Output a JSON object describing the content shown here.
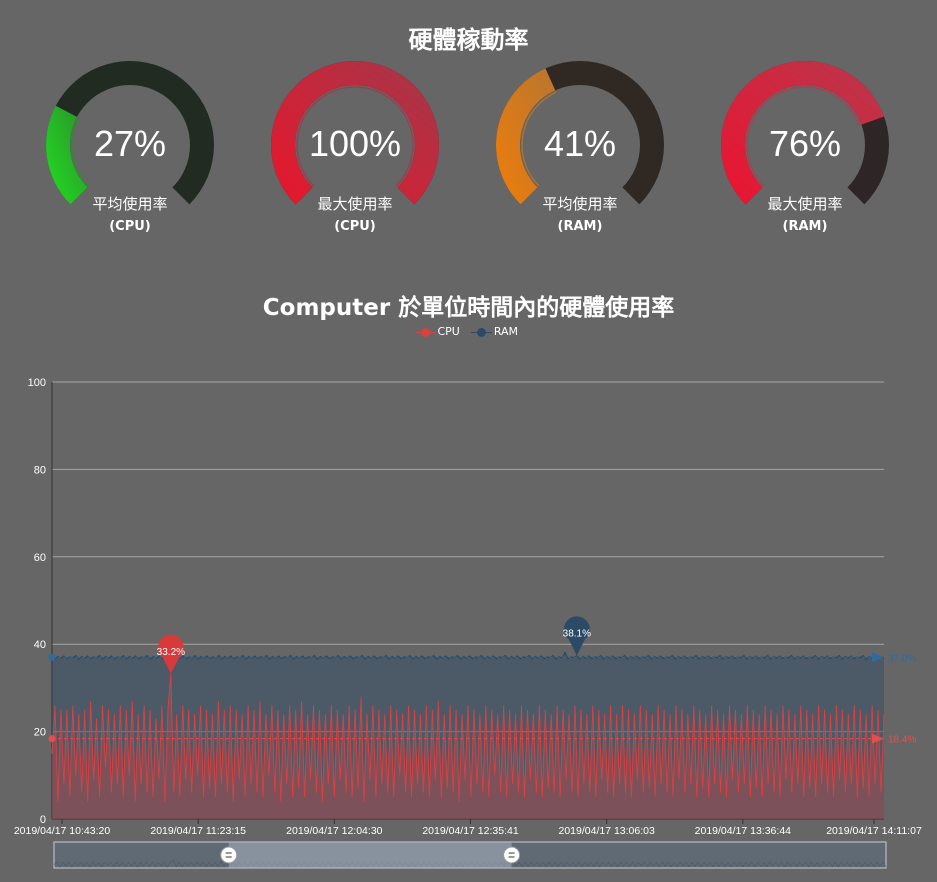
{
  "header": {
    "title": "硬體稼動率"
  },
  "gauges": [
    {
      "value_text": "27%",
      "value": 27,
      "label": "平均使用率",
      "sub": "(CPU)",
      "track_color": "#212b22",
      "fill_start": "#22e022",
      "fill_end": "#2b8e2b"
    },
    {
      "value_text": "100%",
      "value": 100,
      "label": "最大使用率",
      "sub": "(CPU)",
      "track_color": "#2a1d1d",
      "fill_start": "#e8162b",
      "fill_end": "#a3384a"
    },
    {
      "value_text": "41%",
      "value": 41,
      "label": "平均使用率",
      "sub": "(RAM)",
      "track_color": "#2f2823",
      "fill_start": "#ef7d0b",
      "fill_end": "#b8762f"
    },
    {
      "value_text": "76%",
      "value": 76,
      "label": "最大使用率",
      "sub": "(RAM)",
      "track_color": "#2e2527",
      "fill_start": "#ec1330",
      "fill_end": "#b8384c"
    }
  ],
  "chart_data": {
    "type": "area",
    "title": "Computer 於單位時間內的硬體使用率",
    "ylim": [
      0,
      100
    ],
    "y_ticks": [
      "0",
      "20",
      "40",
      "60",
      "80",
      "100"
    ],
    "x_ticks": [
      "2019/04/17 10:43:20",
      "2019/04/17 11:23:15",
      "2019/04/17 12:04:30",
      "2019/04/17 12:35:41",
      "2019/04/17 13:06:03",
      "2019/04/17 13:36:44",
      "2019/04/17 14:11:07"
    ],
    "grid": true,
    "legend_position": "top-center",
    "series": [
      {
        "name": "CPU",
        "color": "#d94141",
        "values": [
          15,
          26,
          4,
          25,
          8,
          25,
          5,
          26,
          10,
          24,
          6,
          25,
          4,
          27,
          9,
          23,
          5,
          26,
          12,
          25,
          6,
          24,
          8,
          26,
          5,
          25,
          10,
          27,
          4,
          24,
          8,
          26,
          6,
          25,
          5,
          23,
          9,
          26,
          4,
          25,
          33.2,
          6,
          24,
          5,
          26,
          9,
          25,
          6,
          24,
          10,
          26,
          5,
          25,
          7,
          24,
          5,
          27,
          8,
          25,
          6,
          26,
          4,
          25,
          9,
          24,
          5,
          26,
          8,
          25,
          6,
          27,
          5,
          24,
          10,
          26,
          6,
          25,
          4,
          24,
          8,
          26,
          5,
          25,
          7,
          27,
          5,
          24,
          9,
          26,
          6,
          25,
          4,
          24,
          8,
          26,
          5,
          25,
          9,
          24,
          6,
          26,
          5,
          25,
          7,
          28,
          4,
          24,
          9,
          26,
          5,
          25,
          8,
          24,
          6,
          26,
          5,
          25,
          10,
          24,
          6,
          26,
          5,
          25,
          8,
          24,
          6,
          26,
          5,
          25,
          9,
          27,
          5,
          24,
          7,
          26,
          6,
          25,
          4,
          24,
          9,
          26,
          5,
          25,
          8,
          24,
          6,
          26,
          5,
          25,
          10,
          24,
          6,
          26,
          5,
          25,
          8,
          24,
          6,
          26,
          5,
          25,
          9,
          24,
          6,
          26,
          5,
          25,
          7,
          24,
          6,
          26,
          5,
          25,
          9,
          24,
          6,
          26,
          5,
          25,
          8,
          24,
          6,
          26,
          5,
          25,
          9,
          24,
          6,
          26,
          5,
          24,
          8,
          26,
          6,
          25,
          5,
          24,
          9,
          26,
          6,
          25,
          7,
          24,
          5,
          26,
          8,
          25,
          6,
          24,
          5,
          26,
          9,
          25,
          6,
          24,
          8,
          26,
          5,
          25,
          7,
          24,
          5,
          26,
          8,
          25,
          6,
          24,
          5,
          26,
          9,
          25,
          6,
          24,
          8,
          26,
          5,
          25,
          7,
          24,
          5,
          26,
          8,
          25,
          6,
          24,
          5,
          26,
          9,
          25,
          6,
          24,
          8,
          26,
          5,
          25,
          7,
          24,
          5,
          26,
          8,
          25,
          6,
          24,
          5,
          26,
          9,
          25,
          6,
          24,
          8,
          26,
          5,
          25,
          7,
          24,
          5,
          26,
          8,
          25,
          6,
          24
        ],
        "max_label": "33.2%",
        "max_index": 40,
        "avg": 18.4,
        "avg_label": "18.4%"
      },
      {
        "name": "RAM",
        "color": "#2c4a66",
        "values": [
          37,
          36.6,
          37.2,
          36.8,
          37.3,
          36.7,
          37.1,
          36.9,
          37.4,
          36.6,
          37.2,
          36.8,
          37.3,
          36.7,
          37.1,
          36.9,
          37.4,
          36.6,
          37.2,
          36.8,
          37.3,
          36.7,
          37.1,
          36.9,
          37.4,
          36.6,
          37.2,
          36.8,
          37.3,
          36.7,
          37.1,
          36.9,
          37.4,
          36.6,
          37.2,
          36.8,
          37.3,
          36.7,
          37.1,
          36.9,
          37.4,
          36.6,
          37.2,
          36.8,
          37.3,
          36.7,
          37.1,
          36.9,
          37.4,
          36.6,
          37.2,
          36.8,
          37.3,
          36.7,
          37.1,
          36.9,
          37.4,
          36.6,
          37.2,
          36.8,
          37.3,
          36.7,
          37.1,
          36.9,
          37.4,
          36.6,
          37.2,
          36.8,
          37.3,
          36.7,
          37.1,
          36.9,
          37.4,
          36.6,
          37.2,
          36.8,
          37.3,
          36.7,
          37.1,
          36.9,
          37.4,
          36.6,
          37.2,
          36.8,
          37.3,
          36.7,
          37.1,
          36.9,
          37.4,
          36.6,
          37.2,
          36.8,
          37.3,
          36.7,
          37.1,
          36.9,
          37.4,
          36.6,
          37.2,
          36.8,
          37.3,
          36.7,
          37.1,
          36.9,
          37.4,
          36.6,
          37.2,
          36.8,
          37.3,
          36.7,
          37.1,
          36.9,
          37.4,
          36.6,
          37.2,
          36.8,
          37.3,
          36.7,
          37.1,
          36.9,
          37.4,
          36.6,
          37.2,
          36.8,
          37.3,
          36.7,
          37.1,
          36.9,
          37.4,
          36.6,
          37.2,
          36.8,
          37.3,
          36.7,
          37.1,
          36.9,
          37.4,
          36.6,
          37.2,
          36.8,
          37.3,
          36.7,
          37.1,
          36.9,
          37.4,
          36.6,
          37.2,
          36.8,
          37.3,
          36.7,
          37.1,
          36.9,
          37.4,
          36.6,
          37.2,
          36.8,
          37.3,
          36.7,
          37.1,
          36.9,
          37.4,
          36.6,
          37.2,
          36.8,
          37.3,
          36.7,
          37.1,
          36.9,
          37.4,
          36.6,
          37.2,
          36.8,
          38.1,
          36.7,
          37.1,
          36.9,
          37.4,
          36.6,
          37.2,
          36.8,
          37.3,
          36.7,
          37.1,
          36.9,
          37.4,
          36.6,
          37.2,
          36.8,
          37.3,
          36.7,
          37.1,
          36.9,
          37.4,
          36.6,
          37.2,
          36.8,
          37.3,
          36.7,
          37.1,
          36.9,
          37.4,
          36.6,
          37.2,
          36.8,
          37.3,
          36.7,
          37.1,
          36.9,
          37.4,
          36.6,
          37.2,
          36.8,
          37.3,
          36.7,
          37.1,
          36.9,
          37.4,
          36.6,
          37.2,
          36.8,
          37.3,
          36.7,
          37.1,
          36.9,
          37.4,
          36.6,
          37.2,
          36.8,
          37.3,
          36.7,
          37.1,
          36.9,
          37.4,
          36.6,
          37.2,
          36.8,
          37.3,
          36.7,
          37.1,
          36.9,
          37.4,
          36.6,
          37.2,
          36.8,
          37.3,
          36.7,
          37.1,
          36.9,
          37.4,
          36.6,
          37.2,
          36.8,
          37.3,
          36.7,
          37.1,
          36.9,
          37.4,
          36.6,
          37.2,
          36.8,
          37.3,
          36.7,
          37.1,
          36.9,
          37.4,
          36.6,
          37.2,
          36.8,
          37.3,
          36.7,
          37.1,
          36.9,
          37.4,
          36.6,
          37.2,
          36.8,
          37.3,
          36.7,
          37.1,
          36.9
        ],
        "max_label": "38.1%",
        "max_index": 176,
        "avg": 37.0,
        "avg_label": "37.0%"
      }
    ],
    "data_zoom": {
      "start": 0.21,
      "end": 0.55
    }
  }
}
